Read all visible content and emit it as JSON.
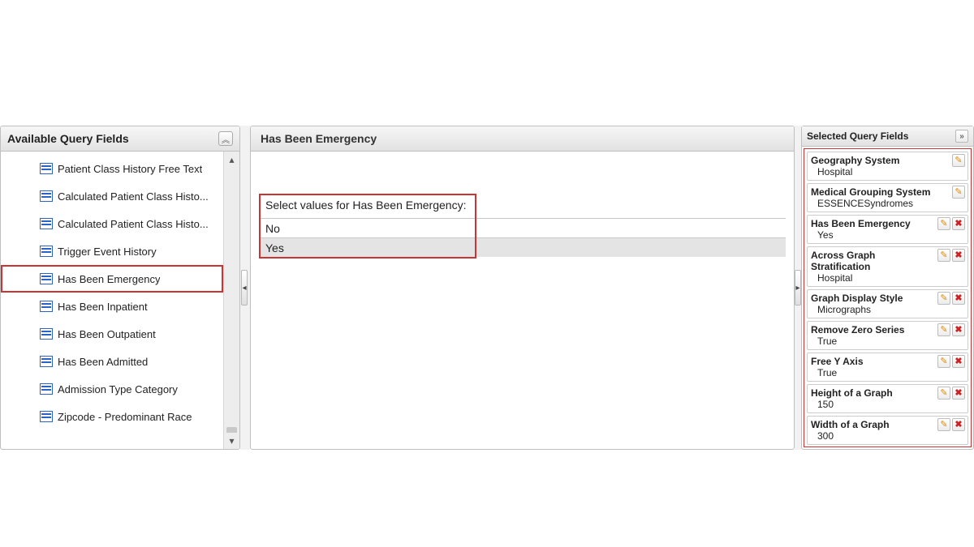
{
  "left": {
    "title": "Available Query Fields",
    "items": [
      "Patient Class History Free Text",
      "Calculated Patient Class Histo...",
      "Calculated Patient Class Histo...",
      "Trigger Event History",
      "Has Been Emergency",
      "Has Been Inpatient",
      "Has Been Outpatient",
      "Has Been Admitted",
      "Admission Type Category",
      "Zipcode - Predominant Race"
    ],
    "selected_index": 4
  },
  "mid": {
    "title": "Has Been Emergency",
    "prompt": "Select values for Has Been Emergency:",
    "options": [
      "No",
      "Yes"
    ],
    "selected_option_index": 1
  },
  "right": {
    "title": "Selected Query Fields",
    "items": [
      {
        "name": "Geography System",
        "value": "Hospital",
        "deletable": false
      },
      {
        "name": "Medical Grouping System",
        "value": "ESSENCESyndromes",
        "deletable": false
      },
      {
        "name": "Has Been Emergency",
        "value": "Yes",
        "deletable": true
      },
      {
        "name": "Across Graph Stratification",
        "value": "Hospital",
        "deletable": true
      },
      {
        "name": "Graph Display Style",
        "value": "Micrographs",
        "deletable": true
      },
      {
        "name": "Remove Zero Series",
        "value": "True",
        "deletable": true
      },
      {
        "name": "Free Y Axis",
        "value": "True",
        "deletable": true
      },
      {
        "name": "Height of a Graph",
        "value": "150",
        "deletable": true
      },
      {
        "name": "Width of a Graph",
        "value": "300",
        "deletable": true
      }
    ]
  },
  "glyph": {
    "chev_up_dbl": "«",
    "chev_right_dbl": "»",
    "tri_left": "◂",
    "tri_right": "▸",
    "tri_up": "▴",
    "tri_down": "▾",
    "pencil": "✎",
    "x": "✖"
  }
}
